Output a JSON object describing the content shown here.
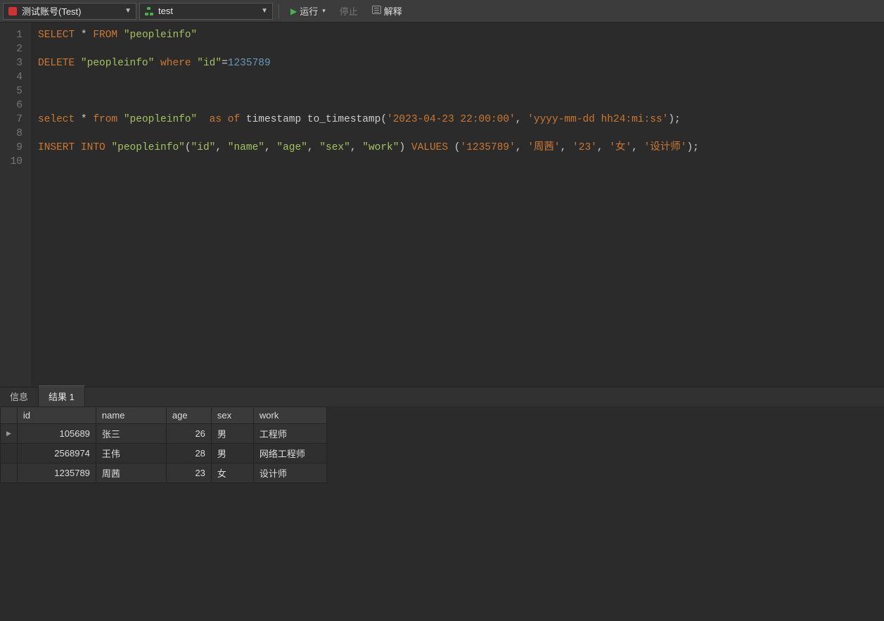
{
  "toolbar": {
    "connection_label": "测试账号(Test)",
    "schema_label": "test",
    "run_label": "运行",
    "stop_label": "停止",
    "explain_label": "解释"
  },
  "editor": {
    "lines": [
      {
        "n": 1,
        "tokens": [
          [
            "kw",
            "SELECT"
          ],
          [
            "",
            ""
          ],
          [
            "",
            "*"
          ],
          [
            "",
            ""
          ],
          [
            "kw",
            "FROM"
          ],
          [
            "",
            ""
          ],
          [
            "str2",
            "\"peopleinfo\""
          ]
        ]
      },
      {
        "n": 2,
        "tokens": []
      },
      {
        "n": 3,
        "tokens": [
          [
            "kw",
            "DELETE"
          ],
          [
            "",
            ""
          ],
          [
            "str2",
            "\"peopleinfo\""
          ],
          [
            "",
            ""
          ],
          [
            "kw2",
            "where"
          ],
          [
            "",
            ""
          ],
          [
            "str2",
            "\"id\""
          ],
          [
            "",
            "="
          ],
          [
            "num",
            "1235789"
          ]
        ]
      },
      {
        "n": 4,
        "tokens": []
      },
      {
        "n": 5,
        "tokens": []
      },
      {
        "n": 6,
        "tokens": []
      },
      {
        "n": 7,
        "tokens": [
          [
            "kw",
            "select"
          ],
          [
            "",
            ""
          ],
          [
            "",
            "*"
          ],
          [
            "",
            ""
          ],
          [
            "kw",
            "from"
          ],
          [
            "",
            ""
          ],
          [
            "str2",
            "\"peopleinfo\""
          ],
          [
            "",
            "  "
          ],
          [
            "kw2",
            "as"
          ],
          [
            "",
            ""
          ],
          [
            "kw2",
            "of"
          ],
          [
            "",
            ""
          ],
          [
            "",
            "timestamp to_timestamp("
          ],
          [
            "str",
            "'2023-04-23 22:00:00'"
          ],
          [
            "",
            ", "
          ],
          [
            "str",
            "'yyyy-mm-dd hh24:mi:ss'"
          ],
          [
            "",
            ");"
          ]
        ]
      },
      {
        "n": 8,
        "tokens": []
      },
      {
        "n": 9,
        "tokens": [
          [
            "kw",
            "INSERT"
          ],
          [
            "",
            ""
          ],
          [
            "kw",
            "INTO"
          ],
          [
            "",
            ""
          ],
          [
            "str2",
            "\"peopleinfo\""
          ],
          [
            "",
            "("
          ],
          [
            "str2",
            "\"id\""
          ],
          [
            "",
            ", "
          ],
          [
            "str2",
            "\"name\""
          ],
          [
            "",
            ", "
          ],
          [
            "str2",
            "\"age\""
          ],
          [
            "",
            ", "
          ],
          [
            "str2",
            "\"sex\""
          ],
          [
            "",
            ", "
          ],
          [
            "str2",
            "\"work\""
          ],
          [
            "",
            ") "
          ],
          [
            "kw",
            "VALUES"
          ],
          [
            "",
            ""
          ],
          [
            "",
            "("
          ],
          [
            "str",
            "'1235789'"
          ],
          [
            "",
            ", "
          ],
          [
            "str",
            "'周茜'"
          ],
          [
            "",
            ", "
          ],
          [
            "str",
            "'23'"
          ],
          [
            "",
            ", "
          ],
          [
            "str",
            "'女'"
          ],
          [
            "",
            ", "
          ],
          [
            "str",
            "'设计师'"
          ],
          [
            "",
            ");"
          ]
        ]
      },
      {
        "n": 10,
        "tokens": []
      }
    ]
  },
  "tabs": {
    "info_label": "信息",
    "result_label": "结果 1",
    "active": 1
  },
  "result": {
    "columns": [
      "id",
      "name",
      "age",
      "sex",
      "work"
    ],
    "rows": [
      {
        "id": "105689",
        "name": "张三",
        "age": "26",
        "sex": "男",
        "work": "工程师",
        "selected": true
      },
      {
        "id": "2568974",
        "name": "王伟",
        "age": "28",
        "sex": "男",
        "work": "网络工程师",
        "selected": false
      },
      {
        "id": "1235789",
        "name": "周茜",
        "age": "23",
        "sex": "女",
        "work": "设计师",
        "selected": false
      }
    ]
  }
}
